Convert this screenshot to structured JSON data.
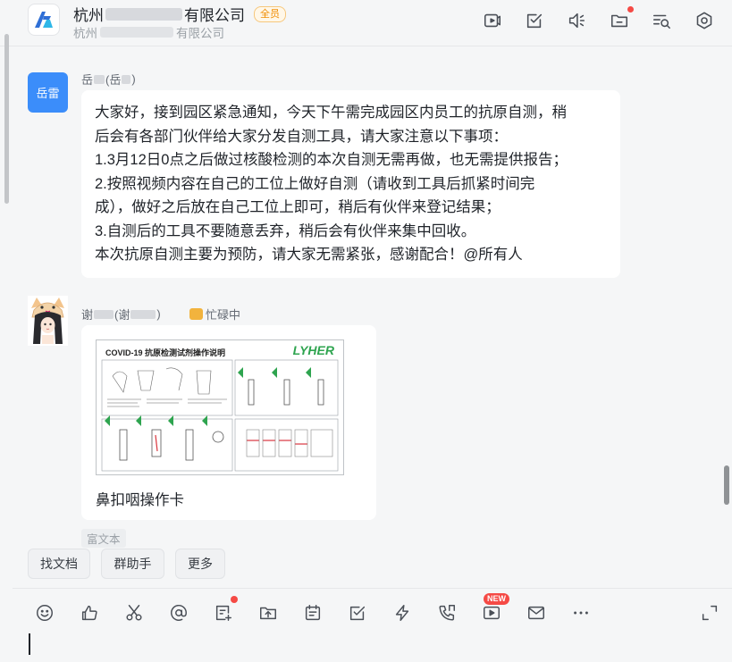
{
  "header": {
    "group_name_start": "杭州",
    "group_name_end": "有限公司",
    "member_badge": "全员",
    "subtitle_start": "杭州",
    "subtitle_end": "有限公司",
    "icons": [
      "video-meeting-icon",
      "todo-icon",
      "announcement-icon",
      "files-icon",
      "search-history-icon",
      "settings-icon"
    ]
  },
  "messages": [
    {
      "sender_start": "岳",
      "sender_paren": "(岳",
      "sender_end": ")",
      "avatar_text": "岳雷",
      "lines": [
        "大家好，接到园区紧急通知，今天下午需完成园区内员工的抗原自测，稍",
        "后会有各部门伙伴给大家分发自测工具，请大家注意以下事项：",
        "1.3月12日0点之后做过核酸检测的本次自测无需再做，也无需提供报告；",
        "2.按照视频内容在自己的工位上做好自测（请收到工具后抓紧时间完",
        "成），做好之后放在自己工位上即可，稍后有伙伴来登记结果；",
        "3.自测后的工具不要随意丢弃，稍后会有伙伴来集中回收。",
        "本次抗原自测主要为预防，请大家无需紧张，感谢配合！@所有人"
      ]
    },
    {
      "sender_start": "谢",
      "sender_paren": "(谢",
      "sender_end": ")",
      "status": "忙碌中",
      "card_image_title": "COVID-19 抗原检测试剂操作说明",
      "card_image_brand": "LYHER",
      "caption": "鼻扣咽操作卡",
      "tag": "富文本"
    }
  ],
  "quick_actions": [
    "找文档",
    "群助手",
    "更多"
  ],
  "toolbar": {
    "icons": [
      "emoji-icon",
      "thumbs-up-icon",
      "screenshot-scissors-icon",
      "mention-icon",
      "doc-add-icon",
      "upload-icon",
      "calendar-icon",
      "task-icon",
      "flash-icon",
      "call-icon",
      "video-icon",
      "mail-icon",
      "more-icon",
      "expand-icon"
    ],
    "new_badge": "NEW"
  },
  "colors": {
    "accent_blue": "#3b8dfa",
    "alert_red": "#f54a45",
    "badge_orange": "#f08c00",
    "card_green": "#2ea44f"
  }
}
